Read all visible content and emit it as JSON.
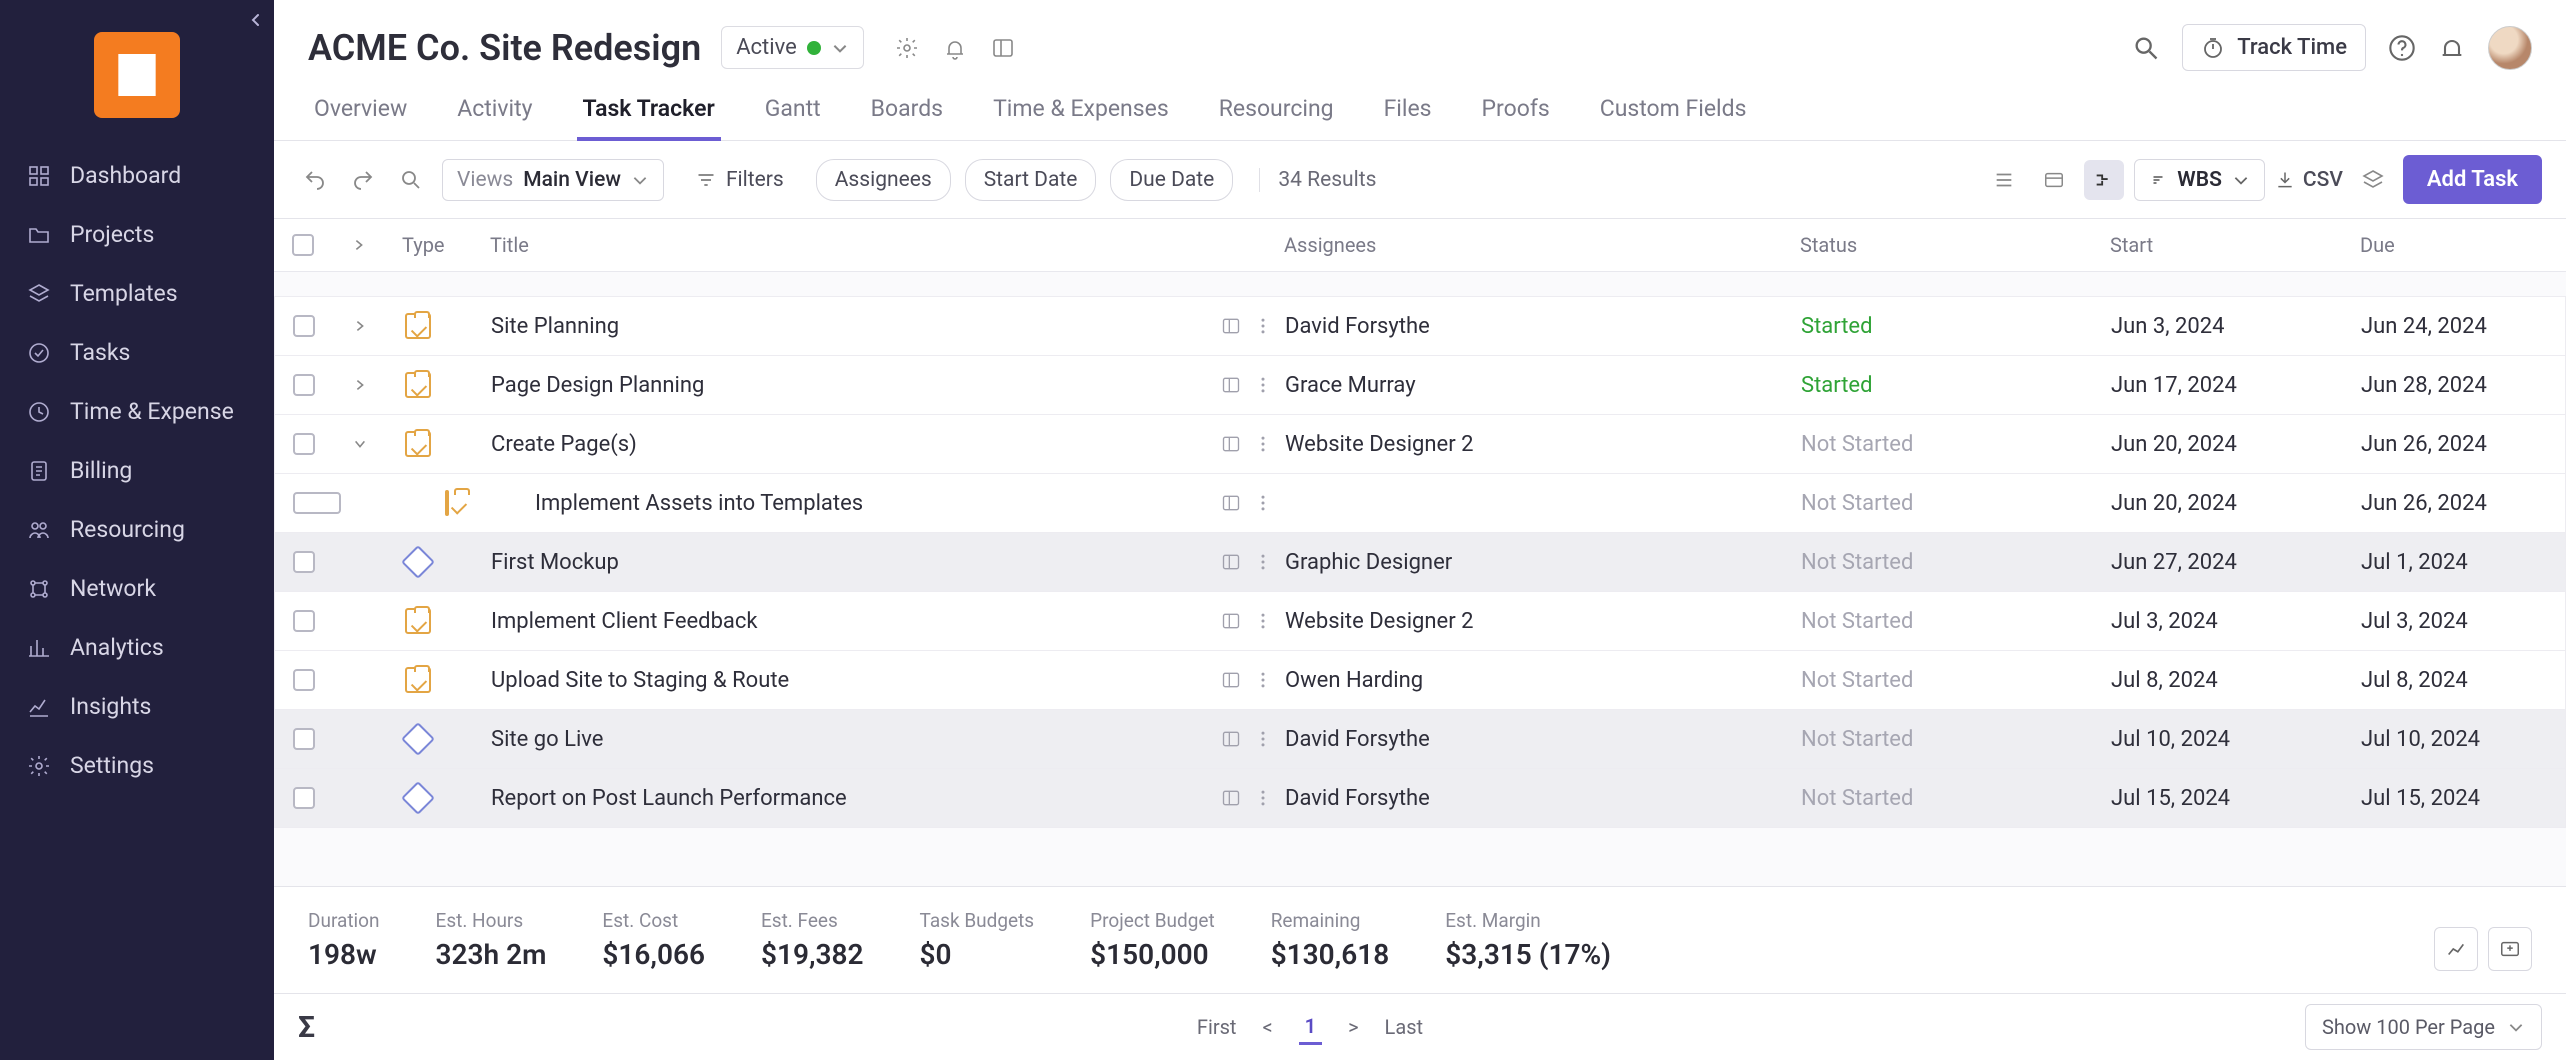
{
  "sidebar": {
    "items": [
      {
        "icon": "dashboard",
        "label": "Dashboard"
      },
      {
        "icon": "folder",
        "label": "Projects"
      },
      {
        "icon": "templates",
        "label": "Templates"
      },
      {
        "icon": "check",
        "label": "Tasks"
      },
      {
        "icon": "clock",
        "label": "Time & Expense"
      },
      {
        "icon": "billing",
        "label": "Billing"
      },
      {
        "icon": "resourcing",
        "label": "Resourcing"
      },
      {
        "icon": "network",
        "label": "Network"
      },
      {
        "icon": "analytics",
        "label": "Analytics"
      },
      {
        "icon": "insights",
        "label": "Insights"
      },
      {
        "icon": "settings",
        "label": "Settings"
      }
    ]
  },
  "header": {
    "title": "ACME Co. Site Redesign",
    "status": "Active",
    "track_time": "Track Time"
  },
  "tabs": [
    {
      "label": "Overview",
      "active": false
    },
    {
      "label": "Activity",
      "active": false
    },
    {
      "label": "Task Tracker",
      "active": true
    },
    {
      "label": "Gantt",
      "active": false
    },
    {
      "label": "Boards",
      "active": false
    },
    {
      "label": "Time & Expenses",
      "active": false
    },
    {
      "label": "Resourcing",
      "active": false
    },
    {
      "label": "Files",
      "active": false
    },
    {
      "label": "Proofs",
      "active": false
    },
    {
      "label": "Custom Fields",
      "active": false
    }
  ],
  "toolbar": {
    "views_label": "Views",
    "views_value": "Main View",
    "filters": "Filters",
    "assignees": "Assignees",
    "start_date": "Start Date",
    "due_date": "Due Date",
    "results": "34 Results",
    "wbs": "WBS",
    "csv": "CSV",
    "add_task": "Add Task"
  },
  "columns": {
    "type": "Type",
    "title": "Title",
    "assignees": "Assignees",
    "status": "Status",
    "start": "Start",
    "due": "Due"
  },
  "rows": [
    {
      "type": "task",
      "expand": "right",
      "title": "Site Planning",
      "assignee": "David Forsythe",
      "status": "Started",
      "statusClass": "started",
      "start": "Jun 3, 2024",
      "due": "Jun 24, 2024",
      "indent": 0,
      "highlight": false
    },
    {
      "type": "task",
      "expand": "right",
      "title": "Page Design Planning",
      "assignee": "Grace Murray",
      "status": "Started",
      "statusClass": "started",
      "start": "Jun 17, 2024",
      "due": "Jun 28, 2024",
      "indent": 0,
      "highlight": false
    },
    {
      "type": "task",
      "expand": "down",
      "title": "Create Page(s)",
      "assignee": "Website Designer 2",
      "status": "Not Started",
      "statusClass": "notstarted",
      "start": "Jun 20, 2024",
      "due": "Jun 26, 2024",
      "indent": 0,
      "highlight": false
    },
    {
      "type": "task",
      "expand": "",
      "title": "Implement Assets into Templates",
      "assignee": "",
      "status": "Not Started",
      "statusClass": "notstarted",
      "start": "Jun 20, 2024",
      "due": "Jun 26, 2024",
      "indent": 1,
      "highlight": false
    },
    {
      "type": "milestone",
      "expand": "",
      "title": "First Mockup",
      "assignee": "Graphic Designer",
      "status": "Not Started",
      "statusClass": "notstarted",
      "start": "Jun 27, 2024",
      "due": "Jul 1, 2024",
      "indent": 0,
      "highlight": true
    },
    {
      "type": "task",
      "expand": "",
      "title": "Implement Client Feedback",
      "assignee": "Website Designer 2",
      "status": "Not Started",
      "statusClass": "notstarted",
      "start": "Jul 3, 2024",
      "due": "Jul 3, 2024",
      "indent": 0,
      "highlight": false
    },
    {
      "type": "task",
      "expand": "",
      "title": "Upload Site to Staging & Route",
      "assignee": "Owen Harding",
      "status": "Not Started",
      "statusClass": "notstarted",
      "start": "Jul 8, 2024",
      "due": "Jul 8, 2024",
      "indent": 0,
      "highlight": false
    },
    {
      "type": "milestone",
      "expand": "",
      "title": "Site go Live",
      "assignee": "David Forsythe",
      "status": "Not Started",
      "statusClass": "notstarted",
      "start": "Jul 10, 2024",
      "due": "Jul 10, 2024",
      "indent": 0,
      "highlight": true
    },
    {
      "type": "milestone",
      "expand": "",
      "title": "Report on Post Launch Performance",
      "assignee": "David Forsythe",
      "status": "Not Started",
      "statusClass": "notstarted",
      "start": "Jul 15, 2024",
      "due": "Jul 15, 2024",
      "indent": 0,
      "highlight": true
    }
  ],
  "summary": {
    "duration": {
      "label": "Duration",
      "value": "198w"
    },
    "est_hours": {
      "label": "Est. Hours",
      "value": "323h 2m"
    },
    "est_cost": {
      "label": "Est. Cost",
      "value": "$16,066"
    },
    "est_fees": {
      "label": "Est. Fees",
      "value": "$19,382"
    },
    "task_budgets": {
      "label": "Task Budgets",
      "value": "$0"
    },
    "project_budget": {
      "label": "Project Budget",
      "value": "$150,000"
    },
    "remaining": {
      "label": "Remaining",
      "value": "$130,618"
    },
    "est_margin": {
      "label": "Est. Margin",
      "value": "$3,315 (17%)"
    }
  },
  "footer": {
    "sigma": "Σ",
    "first": "First",
    "prev": "<",
    "page": "1",
    "next": ">",
    "last": "Last",
    "perpage": "Show 100 Per Page"
  }
}
